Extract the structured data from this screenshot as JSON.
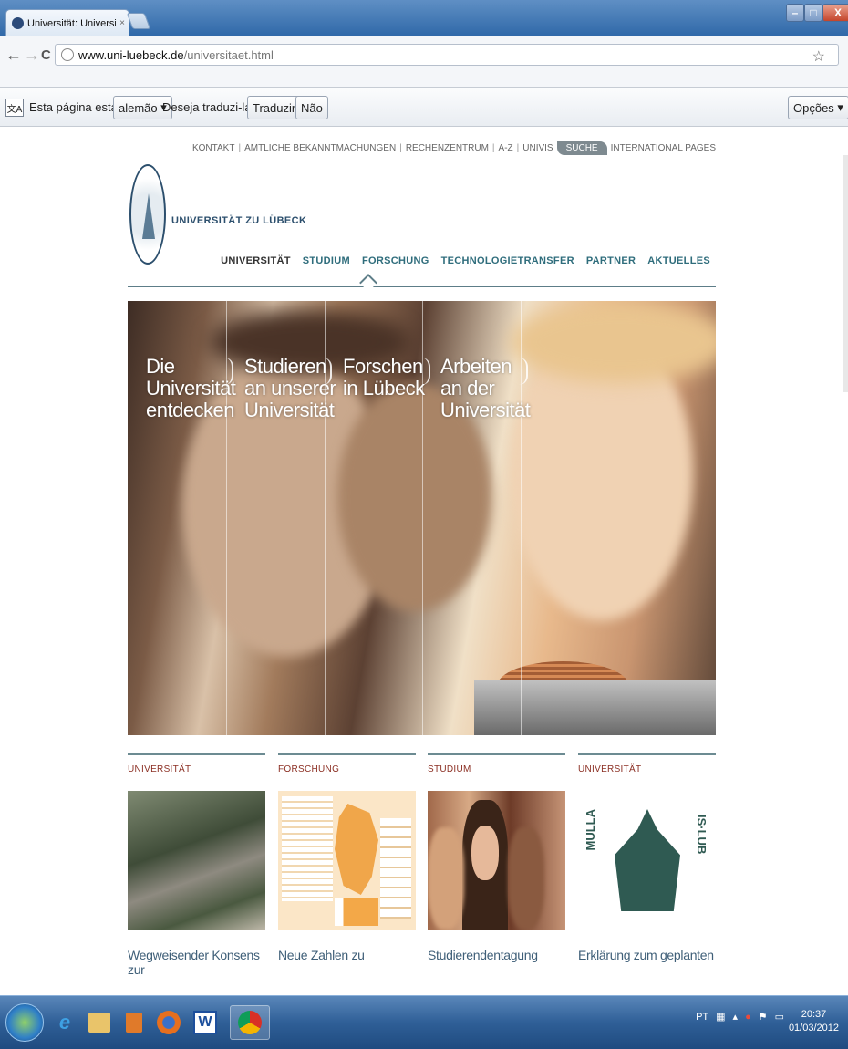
{
  "browser": {
    "tab_title": "Universität: Universität zu L",
    "tab_close": "×",
    "url_host": "www.uni-luebeck.de",
    "url_path": "/universitaet.html",
    "back": "←",
    "forward": "→",
    "reload": "C",
    "star": "☆",
    "window_min": "–",
    "window_max": "□",
    "window_close": "X"
  },
  "translate_bar": {
    "text1": "Esta página está em",
    "language": "alemão",
    "text2": "Deseja traduzi-la?",
    "translate_button": "Traduzir",
    "no_button": "Não",
    "options_button": "Opções"
  },
  "site": {
    "meta_nav": [
      "KONTAKT",
      "AMTLICHE BEKANNTMACHUNGEN",
      "RECHENZENTRUM",
      "A-Z",
      "UNIVIS",
      "SUCHE",
      "INTERNATIONAL PAGES"
    ],
    "meta_active": "SUCHE",
    "logo_text": "UNIVERSITÄT ZU LÜBECK",
    "main_nav": [
      "UNIVERSITÄT",
      "STUDIUM",
      "FORSCHUNG",
      "TECHNOLOGIETRANSFER",
      "PARTNER",
      "AKTUELLES"
    ],
    "hero_panels": [
      {
        "lines": [
          "Die",
          "Universität",
          "entdecken"
        ]
      },
      {
        "lines": [
          "Studieren",
          "an unserer",
          "Universität"
        ]
      },
      {
        "lines": [
          "Forschen",
          "in Lübeck"
        ]
      },
      {
        "lines": [
          "Arbeiten",
          "an der",
          "Universität"
        ]
      }
    ],
    "teasers": [
      {
        "category": "UNIVERSITÄT",
        "headline": "Wegweisender Konsens zur"
      },
      {
        "category": "FORSCHUNG",
        "headline": "Neue Zahlen zu"
      },
      {
        "category": "STUDIUM",
        "headline": "Studierendentagung"
      },
      {
        "category": "UNIVERSITÄT",
        "headline": "Erklärung zum geplanten"
      }
    ]
  },
  "taskbar": {
    "language": "PT",
    "time": "20:37",
    "date": "01/03/2012"
  }
}
